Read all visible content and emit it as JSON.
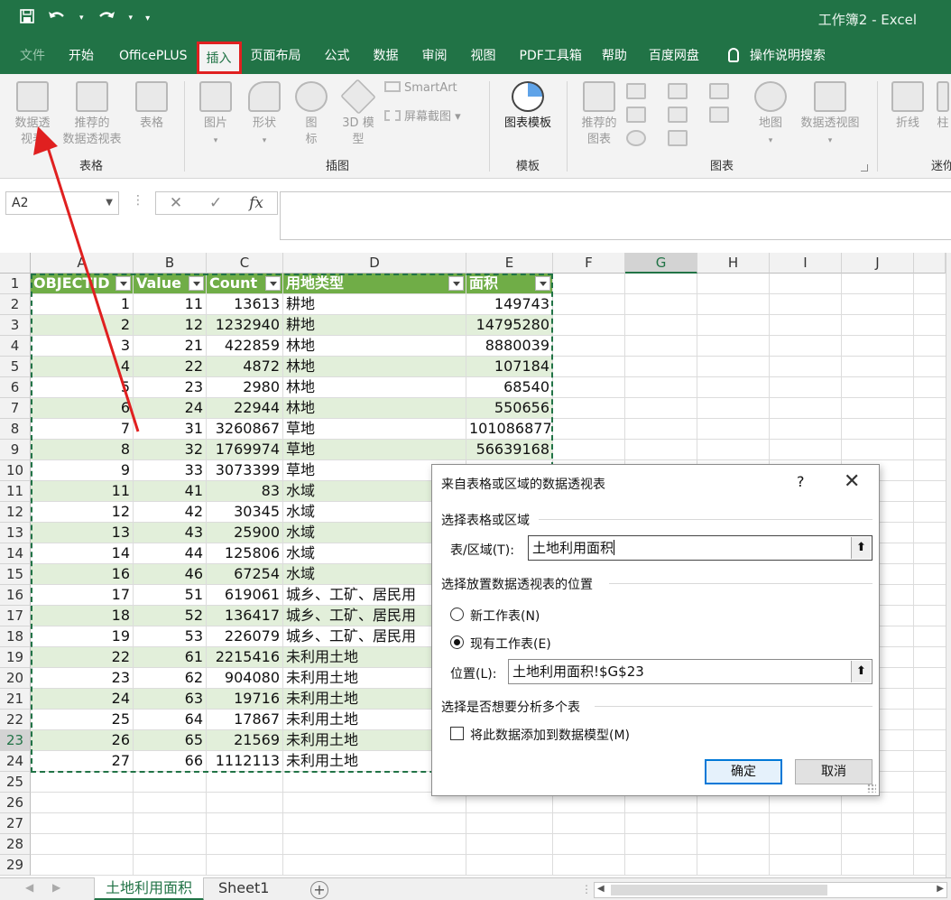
{
  "window": {
    "title": "工作簿2 - Excel"
  },
  "qat": {
    "save_icon": "save-icon",
    "undo_icon": "undo-icon",
    "redo_icon": "redo-icon",
    "more": "▾"
  },
  "tabs": [
    {
      "label": "文件"
    },
    {
      "label": "开始"
    },
    {
      "label": "OfficePLUS"
    },
    {
      "label": "插入"
    },
    {
      "label": "页面布局"
    },
    {
      "label": "公式"
    },
    {
      "label": "数据"
    },
    {
      "label": "审阅"
    },
    {
      "label": "视图"
    },
    {
      "label": "PDF工具箱"
    },
    {
      "label": "帮助"
    },
    {
      "label": "百度网盘"
    },
    {
      "label": "操作说明搜索"
    }
  ],
  "ribbon": {
    "groups": {
      "tables": "表格",
      "illustrations": "插图",
      "templates": "模板",
      "charts": "图表",
      "sparklines": "迷你"
    },
    "pivot": "数据透\n视表",
    "pivot_l1": "数据透",
    "pivot_l2": "视表",
    "rec_pivot_l1": "推荐的",
    "rec_pivot_l2": "数据透视表",
    "table": "表格",
    "picture": "图片",
    "shapes": "形状",
    "icons_l1": "图",
    "icons_l2": "标",
    "model_l1": "3D 模",
    "model_l2": "型",
    "smartart": "SmartArt",
    "screenshot": "屏幕截图",
    "chart_template": "图表模板",
    "rec_chart_l1": "推荐的",
    "rec_chart_l2": "图表",
    "map": "地图",
    "pivot_chart": "数据透视图",
    "line": "折线",
    "column_partial": "柱"
  },
  "formula_bar": {
    "name_box": "A2",
    "cancel": "✕",
    "enter": "✓",
    "fx": "fx",
    "content": ""
  },
  "columns": [
    "A",
    "B",
    "C",
    "D",
    "E",
    "F",
    "G",
    "H",
    "I",
    "J"
  ],
  "table": {
    "headers": [
      "OBJECTID",
      "Value",
      "Count",
      "用地类型",
      "面积"
    ],
    "rows": [
      [
        "1",
        "11",
        "13613",
        "耕地",
        "149743"
      ],
      [
        "2",
        "12",
        "1232940",
        "耕地",
        "14795280"
      ],
      [
        "3",
        "21",
        "422859",
        "林地",
        "8880039"
      ],
      [
        "4",
        "22",
        "4872",
        "林地",
        "107184"
      ],
      [
        "5",
        "23",
        "2980",
        "林地",
        "68540"
      ],
      [
        "6",
        "24",
        "22944",
        "林地",
        "550656"
      ],
      [
        "7",
        "31",
        "3260867",
        "草地",
        "101086877"
      ],
      [
        "8",
        "32",
        "1769974",
        "草地",
        "56639168"
      ],
      [
        "9",
        "33",
        "3073399",
        "草地",
        ""
      ],
      [
        "11",
        "41",
        "83",
        "水域",
        ""
      ],
      [
        "12",
        "42",
        "30345",
        "水域",
        ""
      ],
      [
        "13",
        "43",
        "25900",
        "水域",
        ""
      ],
      [
        "14",
        "44",
        "125806",
        "水域",
        ""
      ],
      [
        "16",
        "46",
        "67254",
        "水域",
        ""
      ],
      [
        "17",
        "51",
        "619061",
        "城乡、工矿、居民用",
        ""
      ],
      [
        "18",
        "52",
        "136417",
        "城乡、工矿、居民用",
        ""
      ],
      [
        "19",
        "53",
        "226079",
        "城乡、工矿、居民用",
        ""
      ],
      [
        "22",
        "61",
        "2215416",
        "未利用土地",
        ""
      ],
      [
        "23",
        "62",
        "904080",
        "未利用土地",
        ""
      ],
      [
        "24",
        "63",
        "19716",
        "未利用土地",
        ""
      ],
      [
        "25",
        "64",
        "17867",
        "未利用土地",
        ""
      ],
      [
        "26",
        "65",
        "21569",
        "未利用土地",
        ""
      ],
      [
        "27",
        "66",
        "1112113",
        "未利用土地",
        ""
      ]
    ]
  },
  "row_numbers": [
    "1",
    "2",
    "3",
    "4",
    "5",
    "6",
    "7",
    "8",
    "9",
    "10",
    "11",
    "12",
    "13",
    "14",
    "15",
    "16",
    "17",
    "18",
    "19",
    "20",
    "21",
    "22",
    "23",
    "24",
    "25",
    "26",
    "27",
    "28",
    "29"
  ],
  "sheet_tabs": {
    "active": "土地利用面积",
    "other": "Sheet1",
    "add": "+"
  },
  "dialog": {
    "title": "来自表格或区域的数据透视表",
    "help": "?",
    "close": "✕",
    "section1": "选择表格或区域",
    "range_label": "表/区域(T):",
    "range_value": "土地利用面积",
    "section2": "选择放置数据透视表的位置",
    "opt_new": "新工作表(N)",
    "opt_existing": "现有工作表(E)",
    "location_label": "位置(L):",
    "location_value": "土地利用面积!$G$23",
    "section3": "选择是否想要分析多个表",
    "add_model": "将此数据添加到数据模型(M)",
    "ok": "确定",
    "cancel": "取消",
    "selected_option": "existing",
    "add_model_checked": false
  },
  "colors": {
    "accent": "#217346",
    "header_fill": "#70ad47",
    "band_fill": "#e2efda",
    "annotation": "#e02020"
  }
}
